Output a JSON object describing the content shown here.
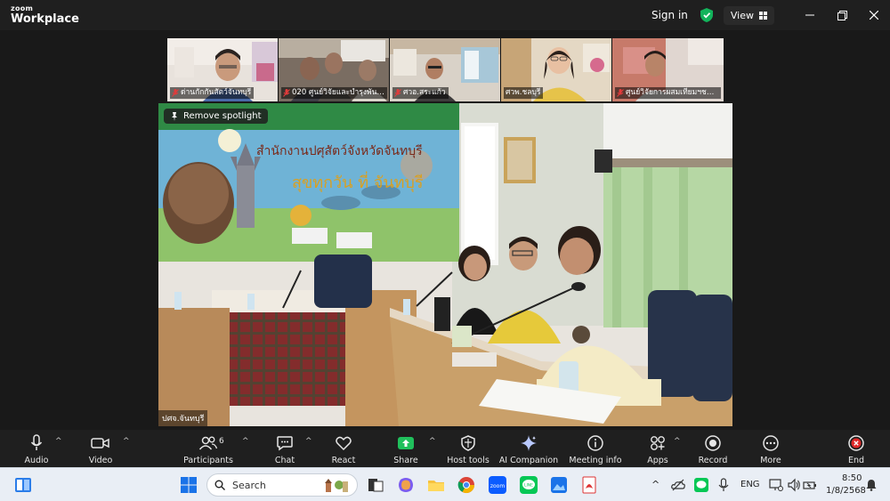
{
  "app": {
    "brand_top": "zoom",
    "brand_bottom": "Workplace"
  },
  "titlebar": {
    "signin": "Sign in",
    "view_label": "View"
  },
  "colors": {
    "accent_blue": "#0b5cff",
    "green": "#12b35b",
    "end_red": "#e02828",
    "share_green": "#20c05c"
  },
  "participants": [
    {
      "name": "ด่านกักกันสัตว์จันทบุรี",
      "muted": true
    },
    {
      "name": "020 ศูนย์วิจัยและบำรุงพันธุ์...",
      "muted": true
    },
    {
      "name": "ศวอ.สระแก้ว",
      "muted": true
    },
    {
      "name": "ศวพ.ชลบุรี",
      "muted": false
    },
    {
      "name": "ศูนย์วิจัยการผสมเทียมฯชล...",
      "muted": true
    }
  ],
  "spotlight": {
    "remove_label": "Remove spotlight",
    "speaker_name": "ปศจ.จันทบุรี"
  },
  "toolbar": {
    "audio": "Audio",
    "video": "Video",
    "participants": "Participants",
    "participants_count": "6",
    "chat": "Chat",
    "react": "React",
    "share": "Share",
    "host_tools": "Host tools",
    "ai_companion": "AI Companion",
    "meeting_info": "Meeting info",
    "apps": "Apps",
    "record": "Record",
    "more": "More",
    "end": "End"
  },
  "taskbar": {
    "search_placeholder": "Search",
    "lang": "ENG",
    "time": "8:50",
    "date": "1/8/2568"
  }
}
